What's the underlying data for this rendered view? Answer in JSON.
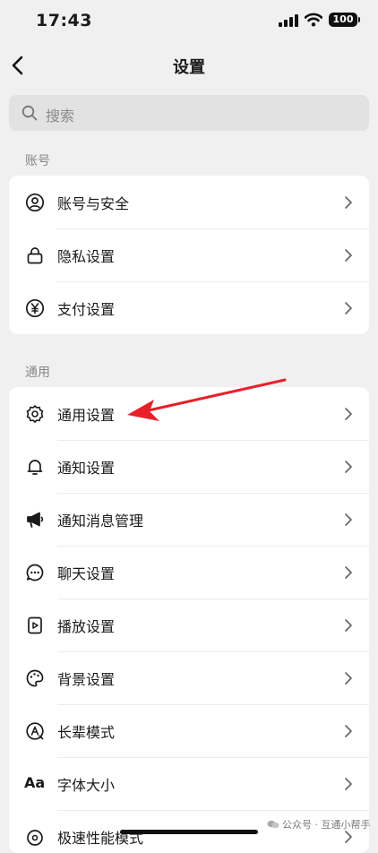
{
  "status": {
    "time": "17:43",
    "battery": "100"
  },
  "nav": {
    "title": "设置"
  },
  "search": {
    "placeholder": "搜索"
  },
  "sections": [
    {
      "label": "账号",
      "items": [
        {
          "label": "账号与安全",
          "icon": "account-icon"
        },
        {
          "label": "隐私设置",
          "icon": "lock-icon"
        },
        {
          "label": "支付设置",
          "icon": "yen-icon"
        }
      ]
    },
    {
      "label": "通用",
      "items": [
        {
          "label": "通用设置",
          "icon": "gear-icon"
        },
        {
          "label": "通知设置",
          "icon": "bell-icon"
        },
        {
          "label": "通知消息管理",
          "icon": "megaphone-icon"
        },
        {
          "label": "聊天设置",
          "icon": "chat-bubble-icon"
        },
        {
          "label": "播放设置",
          "icon": "play-icon"
        },
        {
          "label": "背景设置",
          "icon": "palette-icon"
        },
        {
          "label": "长辈模式",
          "icon": "elder-mode-icon"
        },
        {
          "label": "字体大小",
          "icon": "font-size-icon",
          "glyph": "Aa"
        },
        {
          "label": "极速性能模式",
          "icon": "speed-icon"
        }
      ]
    }
  ],
  "watermark": {
    "text": "公众号 · 互通小帮手"
  },
  "colors": {
    "annotation_arrow": "#e8202a",
    "background": "#f0f0f0"
  }
}
